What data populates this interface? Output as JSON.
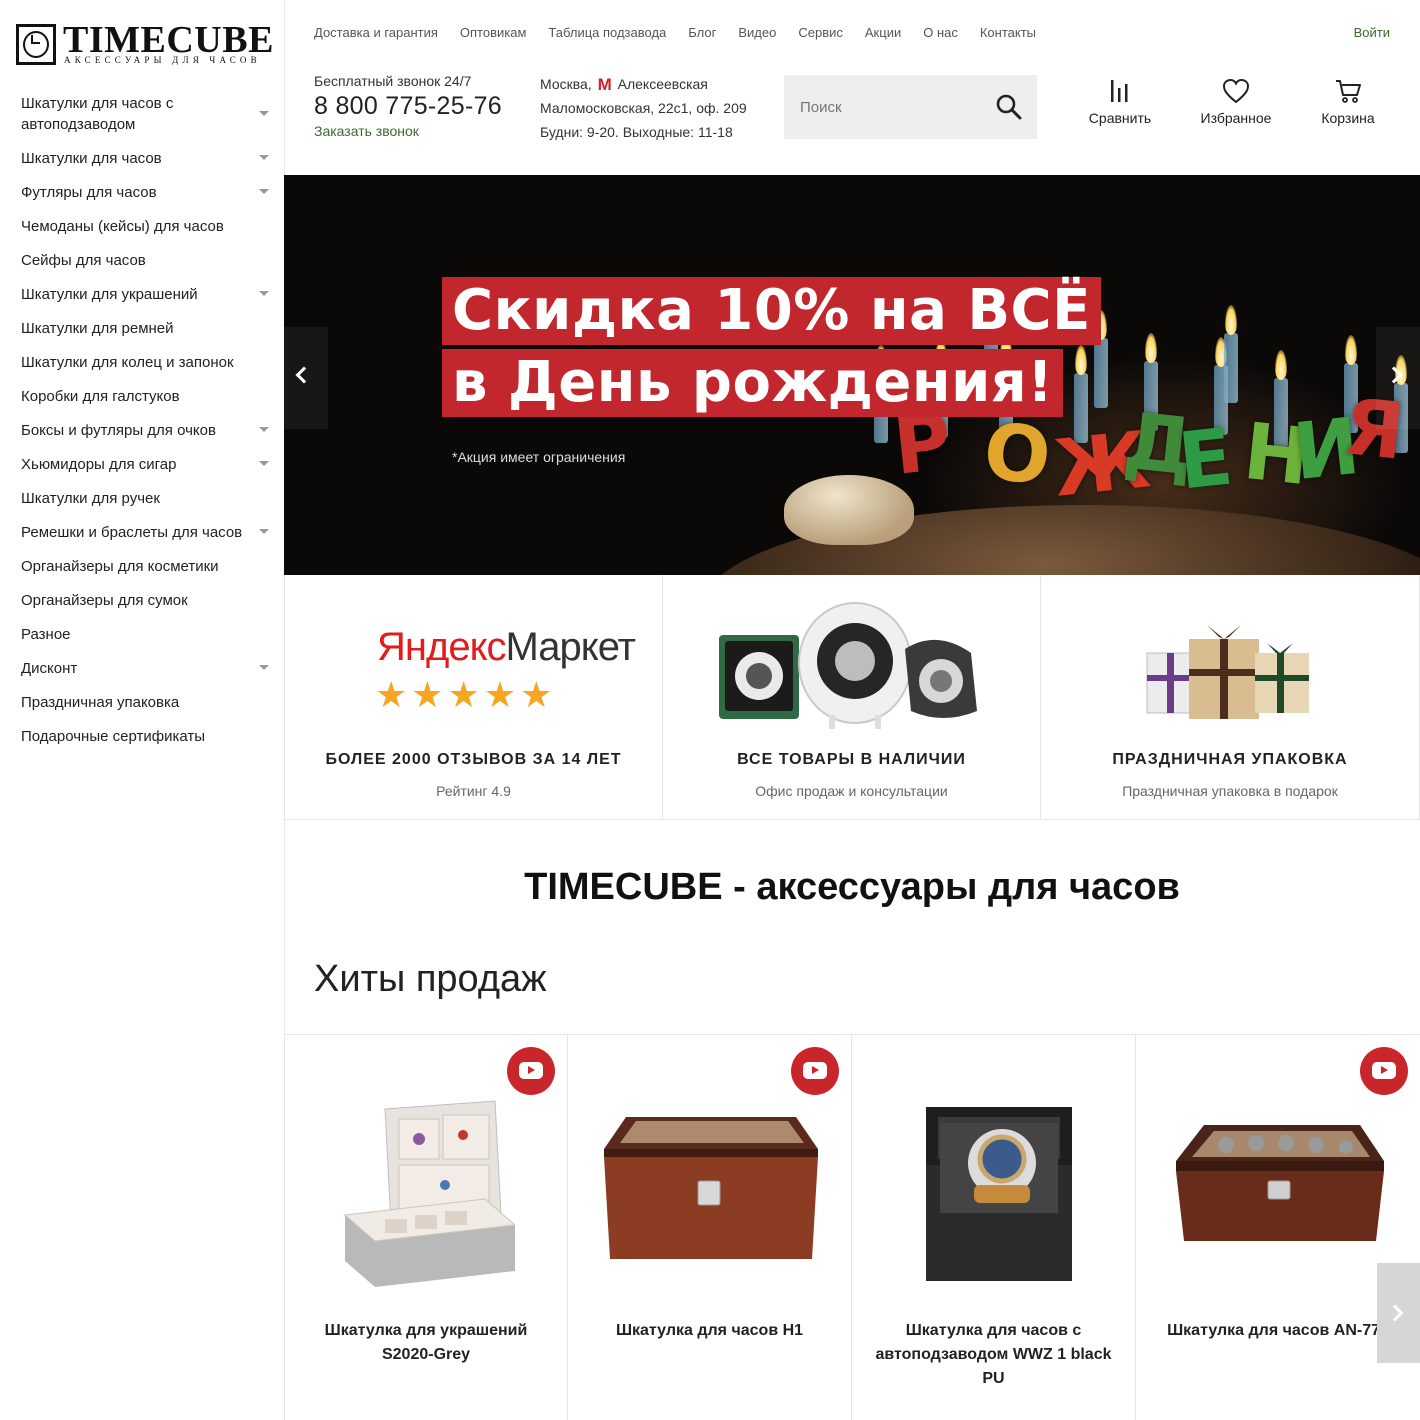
{
  "brand": {
    "name": "TIMECUBE",
    "tagline": "АКСЕССУАРЫ ДЛЯ ЧАСОВ"
  },
  "sidebar": {
    "items": [
      {
        "label": "Шкатулки для часов с автоподзаводом",
        "has_submenu": true
      },
      {
        "label": "Шкатулки для часов",
        "has_submenu": true
      },
      {
        "label": "Футляры для часов",
        "has_submenu": true
      },
      {
        "label": "Чемоданы (кейсы) для часов",
        "has_submenu": false
      },
      {
        "label": "Сейфы для часов",
        "has_submenu": false
      },
      {
        "label": "Шкатулки для украшений",
        "has_submenu": true
      },
      {
        "label": "Шкатулки для ремней",
        "has_submenu": false
      },
      {
        "label": "Шкатулки для колец и запонок",
        "has_submenu": false
      },
      {
        "label": "Коробки для галстуков",
        "has_submenu": false
      },
      {
        "label": "Боксы и футляры для очков",
        "has_submenu": true
      },
      {
        "label": "Хьюмидоры для сигар",
        "has_submenu": true
      },
      {
        "label": "Шкатулки для ручек",
        "has_submenu": false
      },
      {
        "label": "Ремешки и браслеты для часов",
        "has_submenu": true
      },
      {
        "label": "Органайзеры для косметики",
        "has_submenu": false
      },
      {
        "label": "Органайзеры для сумок",
        "has_submenu": false
      },
      {
        "label": "Разное",
        "has_submenu": false
      },
      {
        "label": "Дисконт",
        "has_submenu": true
      },
      {
        "label": "Праздничная упаковка",
        "has_submenu": false
      },
      {
        "label": "Подарочные сертификаты",
        "has_submenu": false
      }
    ]
  },
  "topnav": {
    "links": [
      "Доставка и гарантия",
      "Оптовикам",
      "Таблица подзавода",
      "Блог",
      "Видео",
      "Сервис",
      "Акции",
      "О нас",
      "Контакты"
    ],
    "login": "Войти"
  },
  "contacts": {
    "phone_label": "Бесплатный звонок 24/7",
    "phone": "8 800 775-25-76",
    "callback": "Заказать звонок",
    "city": "Москва,",
    "metro_symbol": "М",
    "metro_station": "Алексеевская",
    "address": "Маломосковская, 22с1, оф. 209",
    "hours": "Будни: 9-20. Выходные: 11-18"
  },
  "search": {
    "placeholder": "Поиск"
  },
  "header_actions": {
    "compare": "Сравнить",
    "favorites": "Избранное",
    "cart": "Корзина"
  },
  "banner": {
    "line1": "Скидка 10% на ВСЁ",
    "line2": "в День рождения!",
    "note": "*Акция имеет ограничения",
    "candle_letters": [
      "Р",
      "О",
      "Ж",
      "Д",
      "Е",
      "Н",
      "И",
      "Я"
    ]
  },
  "features": [
    {
      "title": "БОЛЕЕ 2000 ОТЗЫВОВ ЗА 14 ЛЕТ",
      "subtitle": "Рейтинг 4.9",
      "logo_prefix": "Яндекс",
      "logo_suffix": "Маркет",
      "stars": 5
    },
    {
      "title": "ВСЕ ТОВАРЫ В НАЛИЧИИ",
      "subtitle": "Офис продаж и консультации"
    },
    {
      "title": "ПРАЗДНИЧНАЯ УПАКОВКА",
      "subtitle": "Праздничная упаковка в подарок"
    }
  ],
  "main_heading": "TIMECUBE - аксессуары для часов",
  "hits": {
    "heading": "Хиты продаж",
    "products": [
      {
        "name": "Шкатулка для украшений S2020-Grey"
      },
      {
        "name": "Шкатулка для часов H1"
      },
      {
        "name": "Шкатулка для часов с автоподзаводом WWZ 1 black PU"
      },
      {
        "name": "Шкатулка для часов AN-770"
      }
    ]
  },
  "colors": {
    "accent_green": "#3c6a2e",
    "banner_red": "#c1272d",
    "youtube_red": "#c9262b",
    "star_orange": "#f5a623"
  }
}
